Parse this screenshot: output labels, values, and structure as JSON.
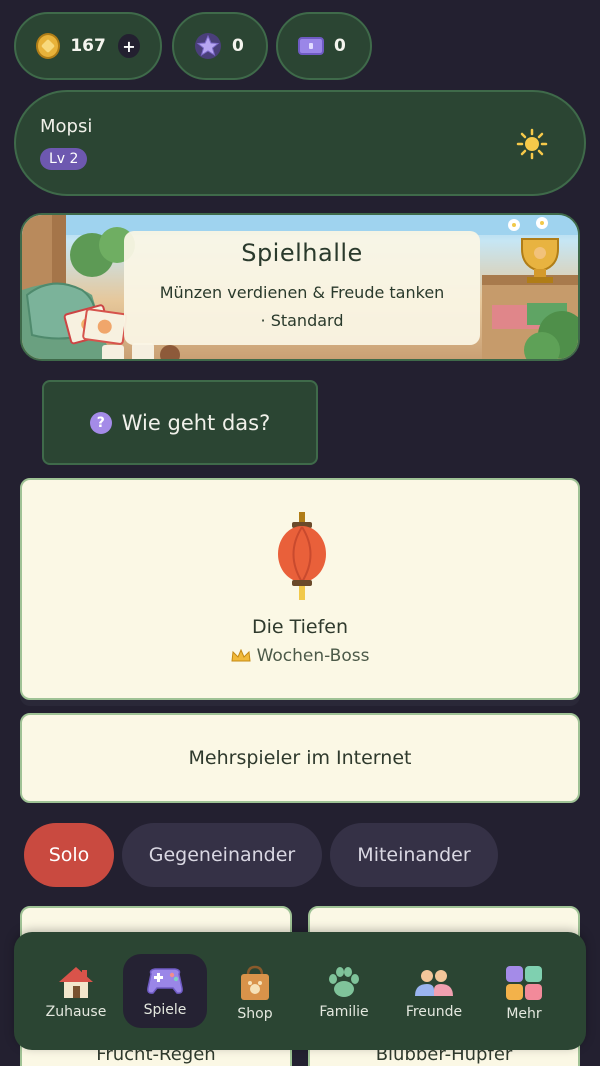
{
  "currency": {
    "coins": "167",
    "add": "+",
    "stars": "0",
    "tickets": "0"
  },
  "profile": {
    "name": "Mopsi",
    "level": "Lv 2"
  },
  "banner": {
    "title": "Spielhalle",
    "subtitle_line1": "Münzen verdienen & Freude tanken",
    "subtitle_line2": "· Standard"
  },
  "howto": {
    "icon": "?",
    "label": "Wie geht das?"
  },
  "boss": {
    "name": "Die Tiefen",
    "tag": "Wochen-Boss"
  },
  "multiplayer": {
    "label": "Mehrspieler im Internet"
  },
  "modes": [
    "Solo",
    "Gegeneinander",
    "Miteinander"
  ],
  "games": [
    "Frucht-Regen",
    "Blubber-Hupfer"
  ],
  "nav": [
    {
      "label": "Zuhause",
      "icon": "house-icon"
    },
    {
      "label": "Spiele",
      "icon": "gamepad-icon"
    },
    {
      "label": "Shop",
      "icon": "shopping-bag-icon"
    },
    {
      "label": "Familie",
      "icon": "paw-icon"
    },
    {
      "label": "Freunde",
      "icon": "friends-icon"
    },
    {
      "label": "Mehr",
      "icon": "grid-icon"
    }
  ],
  "colors": {
    "background": "#232030",
    "panel": "#2b4533",
    "card": "#fbf8e5",
    "accent_red": "#c94a40",
    "level_purple": "#6d58b0"
  }
}
